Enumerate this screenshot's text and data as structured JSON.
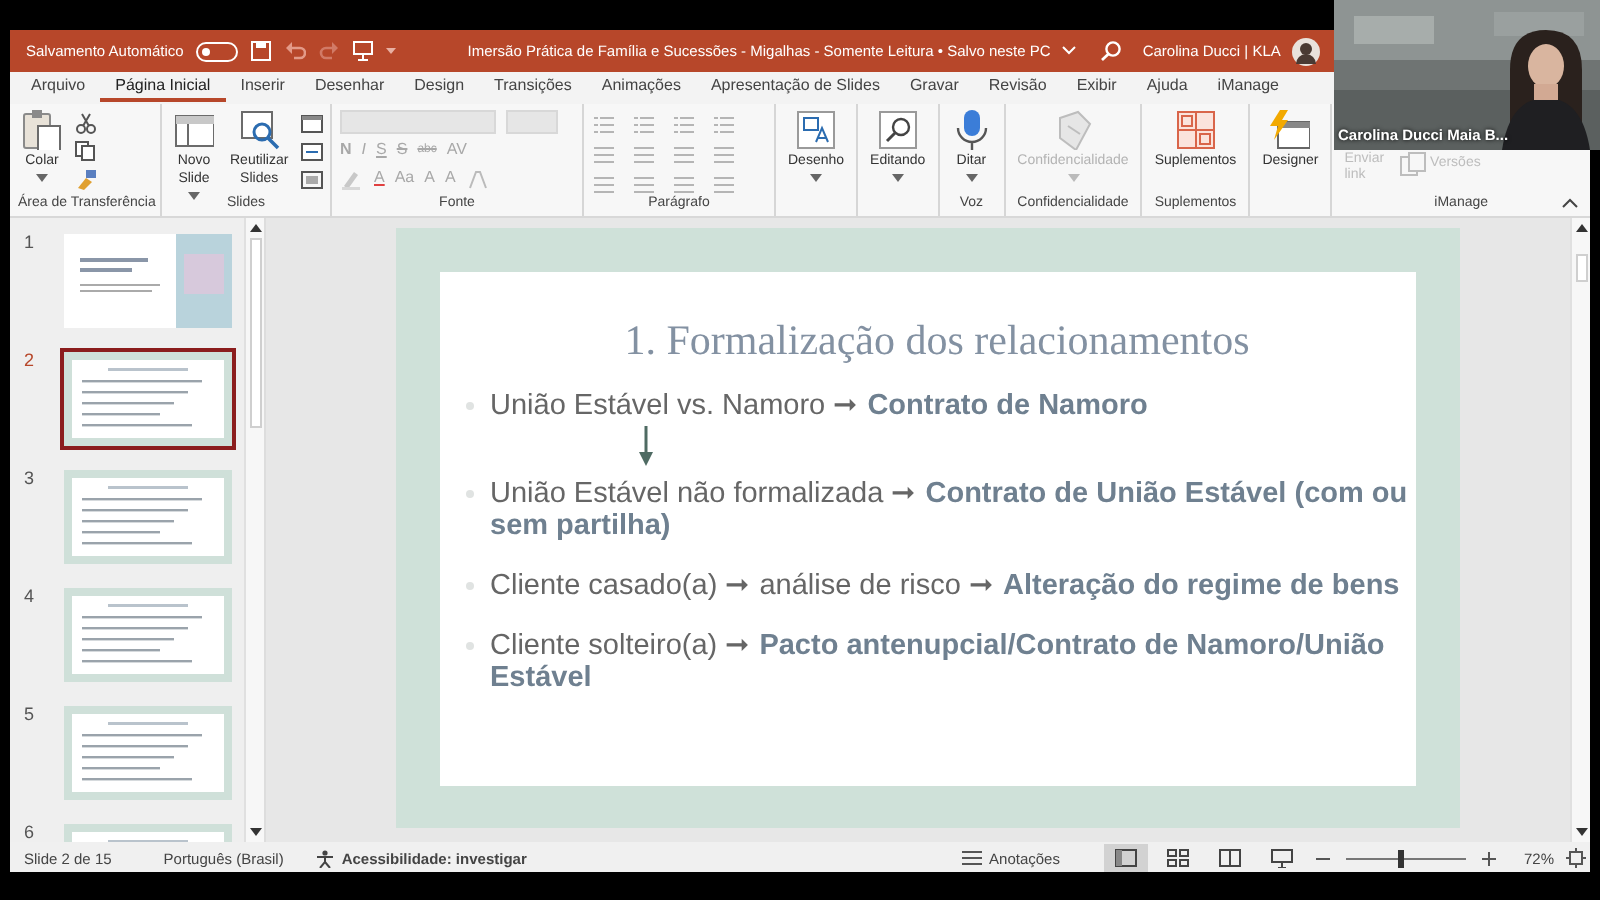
{
  "title_bar": {
    "autosave_label": "Salvamento Automático",
    "autosave_on": false,
    "title": "Imersão Prática de Família e Sucessões - Migalhas - Somente Leitura • Salvo neste PC",
    "user": "Carolina Ducci | KLA"
  },
  "tabs": [
    {
      "label": "Arquivo",
      "selected": false
    },
    {
      "label": "Página Inicial",
      "selected": true
    },
    {
      "label": "Inserir",
      "selected": false
    },
    {
      "label": "Desenhar",
      "selected": false
    },
    {
      "label": "Design",
      "selected": false
    },
    {
      "label": "Transições",
      "selected": false
    },
    {
      "label": "Animações",
      "selected": false
    },
    {
      "label": "Apresentação de Slides",
      "selected": false
    },
    {
      "label": "Gravar",
      "selected": false
    },
    {
      "label": "Revisão",
      "selected": false
    },
    {
      "label": "Exibir",
      "selected": false
    },
    {
      "label": "Ajuda",
      "selected": false
    },
    {
      "label": "iManage",
      "selected": false
    }
  ],
  "ribbon": {
    "groups": [
      {
        "kind": "clipboard",
        "label": "Área de Transferência",
        "buttons": [
          {
            "label": "Colar",
            "kind": "paste",
            "disabled": false,
            "dropdown": true
          }
        ]
      },
      {
        "kind": "slides",
        "label": "Slides",
        "buttons": [
          {
            "label": "Novo Slide",
            "kind": "newslide",
            "disabled": false,
            "dropdown": true
          },
          {
            "label": "Reutilizar Slides",
            "kind": "reuse",
            "disabled": false,
            "dropdown": false
          }
        ]
      },
      {
        "kind": "font",
        "label": "Fonte",
        "styles": [
          "N",
          "I",
          "S",
          "S",
          "abc",
          "AV"
        ],
        "sizes": [
          "A",
          "Aa",
          "A",
          "A"
        ]
      },
      {
        "kind": "paragraph",
        "label": "Parágrafo"
      },
      {
        "kind": "large",
        "buttons": [
          {
            "label": "Desenho",
            "kind": "draw",
            "disabled": false,
            "dropdown": true
          }
        ]
      },
      {
        "kind": "large",
        "buttons": [
          {
            "label": "Editando",
            "kind": "find",
            "disabled": false,
            "dropdown": true
          }
        ]
      },
      {
        "kind": "large",
        "label": "Voz",
        "buttons": [
          {
            "label": "Ditar",
            "kind": "mic",
            "disabled": false,
            "dropdown": true
          }
        ]
      },
      {
        "kind": "large",
        "label": "Confidencialidade",
        "buttons": [
          {
            "label": "Confidencialidade",
            "kind": "shield",
            "disabled": true,
            "dropdown": true
          }
        ]
      },
      {
        "kind": "large",
        "label": "Suplementos",
        "buttons": [
          {
            "label": "Suplementos",
            "kind": "addins",
            "disabled": false,
            "dropdown": false
          }
        ]
      },
      {
        "kind": "large",
        "buttons": [
          {
            "label": "Designer",
            "kind": "designer",
            "disabled": false,
            "dropdown": false
          }
        ]
      },
      {
        "kind": "imanage",
        "label": "iManage",
        "buttons": [
          {
            "label": "Enviar link",
            "kind": "link",
            "disabled": true
          },
          {
            "label": "Versões",
            "kind": "versions",
            "disabled": true
          }
        ]
      }
    ]
  },
  "slides": [
    {
      "number": "1",
      "kind": "title",
      "selected": false
    },
    {
      "number": "2",
      "kind": "content",
      "selected": true
    },
    {
      "number": "3",
      "kind": "content",
      "selected": false
    },
    {
      "number": "4",
      "kind": "content",
      "selected": false
    },
    {
      "number": "5",
      "kind": "content",
      "selected": false
    },
    {
      "number": "6",
      "kind": "content",
      "selected": false
    }
  ],
  "slide": {
    "title": "1. Formalização dos relacionamentos",
    "bullets": [
      {
        "text": "União Estável vs. Namoro ➞ **Contrato de Namoro**",
        "arrow_below": true
      },
      {
        "text": "União Estável não formalizada ➞ **Contrato de União Estável (com ou sem partilha)**",
        "arrow_below": false
      },
      {
        "text": "Cliente casado(a) ➞ análise de risco ➞ **Alteração do regime de bens**",
        "arrow_below": false
      },
      {
        "text": "Cliente solteiro(a) ➞ **Pacto antenupcial/Contrato de Namoro/União Estável**",
        "arrow_below": false
      }
    ]
  },
  "status_bar": {
    "slide_info": "Slide 2 de 15",
    "language": "Português (Brasil)",
    "accessibility": "Acessibilidade: investigar",
    "notes": "Anotações",
    "views": [
      {
        "kind": "normal",
        "selected": true
      },
      {
        "kind": "sorter",
        "selected": false
      },
      {
        "kind": "reading",
        "selected": false
      },
      {
        "kind": "show",
        "selected": false
      }
    ],
    "zoom": {
      "level": 0.45,
      "reading": "72%"
    }
  },
  "video": {
    "kind": "picture",
    "name": "Carolina Ducci Maia B..."
  }
}
